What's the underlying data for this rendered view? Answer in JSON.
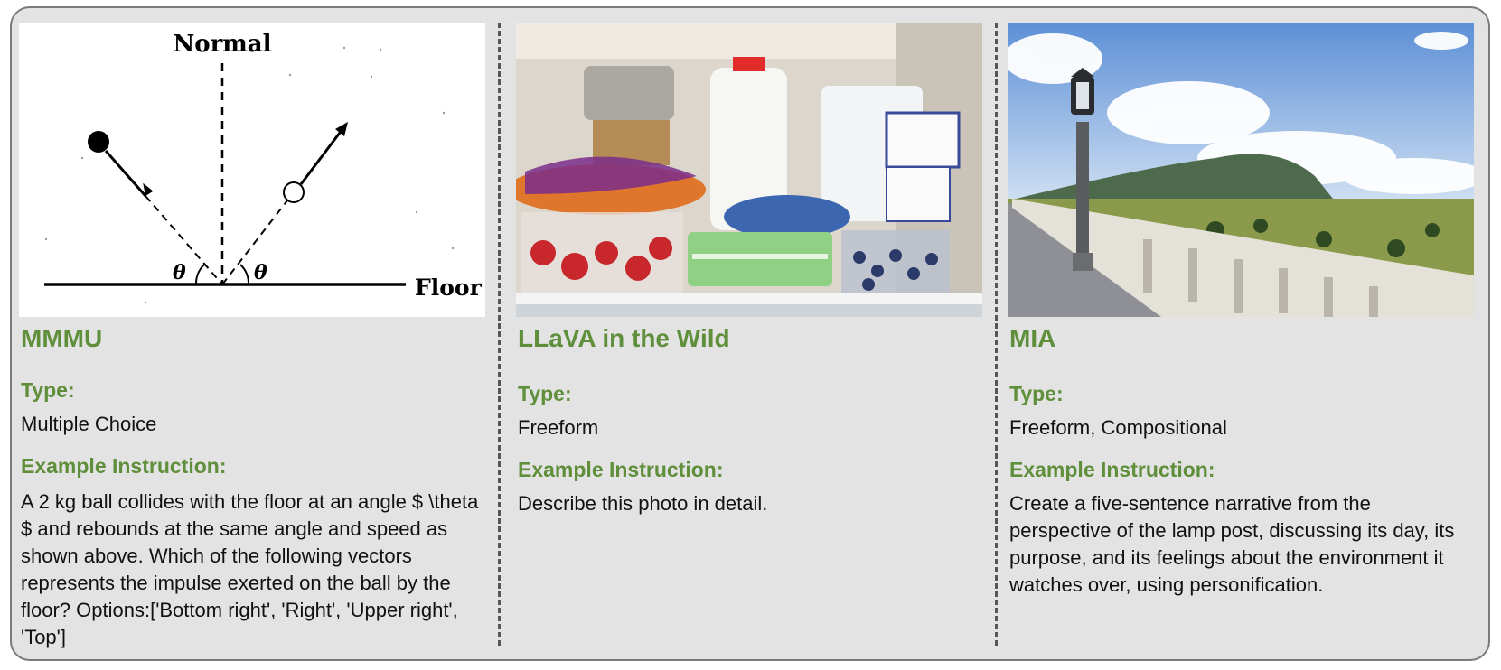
{
  "columns": [
    {
      "title": "MMMU",
      "type_label": "Type:",
      "type_value": "Multiple Choice",
      "instruction_label": "Example Instruction:",
      "instruction_text": "A 2 kg ball collides with the floor at an angle $ \\theta $ and rebounds at the same angle and speed as shown above. Which of the following vectors represents the impulse exerted on the ball by the floor? Options:['Bottom right', 'Right', 'Upper right', 'Top']",
      "figure": {
        "normal_label": "Normal",
        "floor_label": "Floor",
        "angle_label": "θ"
      }
    },
    {
      "title": "LLaVA in the Wild",
      "type_label": "Type:",
      "type_value": "Freeform",
      "instruction_label": "Example Instruction:",
      "instruction_text": "Describe this photo in detail."
    },
    {
      "title": "MIA",
      "type_label": "Type:",
      "type_value": "Freeform, Compositional",
      "instruction_label": "Example Instruction:",
      "instruction_text": "Create a five-sentence narrative from the perspective of the lamp post, discussing its day, its purpose, and its feelings about the environment it watches over, using personification."
    }
  ],
  "colors": {
    "accent": "#5f8f3a",
    "panel_bg": "#e3e3e3",
    "border": "#7a7a7a"
  }
}
